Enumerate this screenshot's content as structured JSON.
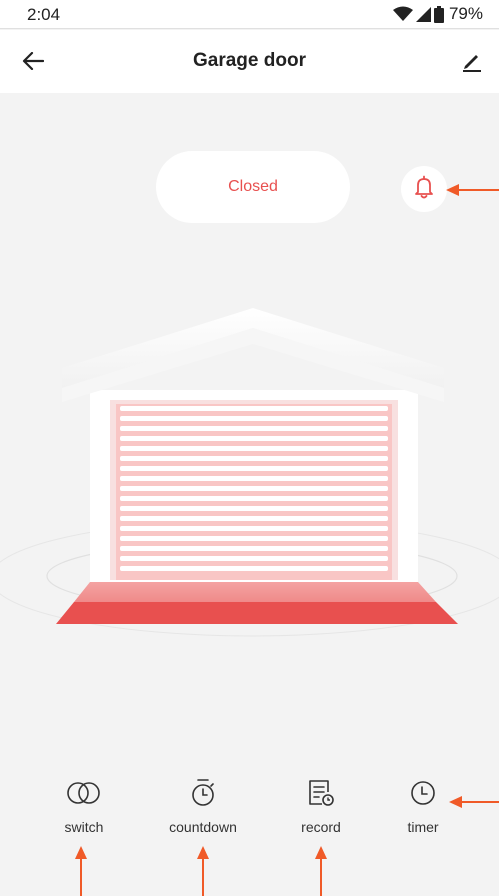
{
  "status_bar": {
    "time": "2:04",
    "battery": "79%",
    "icons": [
      "wifi-icon",
      "cellular-signal-icon",
      "battery-icon"
    ]
  },
  "header": {
    "title": "Garage door",
    "back_icon": "back-arrow-icon",
    "edit_icon": "edit-pencil-icon"
  },
  "device": {
    "state_label": "Closed",
    "alarm_icon": "bell-icon"
  },
  "controls": [
    {
      "label": "switch",
      "icon": "switch-icon"
    },
    {
      "label": "countdown",
      "icon": "stopwatch-icon"
    },
    {
      "label": "record",
      "icon": "record-log-icon"
    },
    {
      "label": "timer",
      "icon": "clock-icon"
    }
  ],
  "colors": {
    "accent": "#e8504f",
    "annotation_arrow": "#f05a28",
    "background": "#f3f3f3",
    "surface": "#ffffff"
  }
}
